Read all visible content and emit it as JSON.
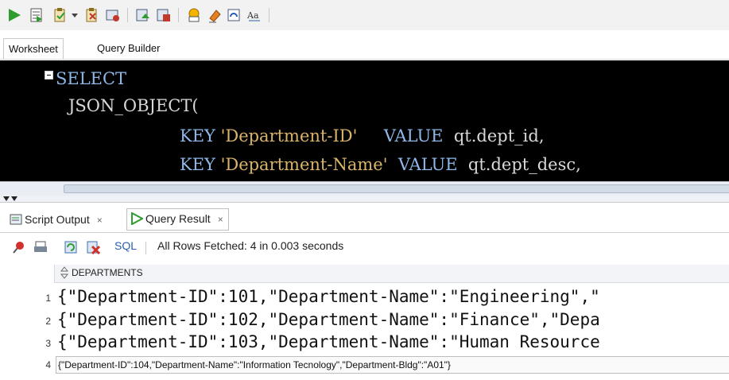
{
  "toolbar": {
    "icons": [
      "run-statement-icon",
      "run-script-icon",
      "commit-icon",
      "dropdown-arrow-icon",
      "rollback-icon",
      "sql-tuning-icon",
      "autotrace-icon",
      "explain-plan-icon",
      "sql-history-icon",
      "clear-icon",
      "format-icon",
      "case-icon"
    ]
  },
  "worksheet_tabs": {
    "worksheet": "Worksheet",
    "query_builder": "Query Builder"
  },
  "editor": {
    "line1": {
      "kw": "SELECT"
    },
    "line2": {
      "text": "JSON_OBJECT("
    },
    "line3": {
      "kw1": "KEY",
      "str": "'Department-ID'",
      "kw2": "VALUE",
      "expr": "qt.dept_id,"
    },
    "line4": {
      "kw1": "KEY",
      "str": "'Department-Name'",
      "kw2": "VALUE",
      "expr": "qt.dept_desc,"
    }
  },
  "bottom_tabs": {
    "script_output": "Script Output",
    "query_result": "Query Result",
    "close": "×"
  },
  "results_toolbar": {
    "sql_label": "SQL",
    "status": "All Rows Fetched: 4 in 0.003 seconds"
  },
  "grid": {
    "column": "DEPARTMENTS",
    "rows": [
      {
        "num": "1",
        "value": "{\"Department-ID\":101,\"Department-Name\":\"Engineering\",\""
      },
      {
        "num": "2",
        "value": "{\"Department-ID\":102,\"Department-Name\":\"Finance\",\"Depa"
      },
      {
        "num": "3",
        "value": "{\"Department-ID\":103,\"Department-Name\":\"Human Resource"
      },
      {
        "num": "4",
        "value": "{\"Department-ID\":104,\"Department-Name\":\"Information Tecnology\",\"Department-Bldg\":\"A01\"}"
      }
    ]
  },
  "colors": {
    "editor_bg": "#000000",
    "keyword": "#8fb7e8",
    "string": "#d9b46a",
    "sql_link": "#2a5db0"
  }
}
